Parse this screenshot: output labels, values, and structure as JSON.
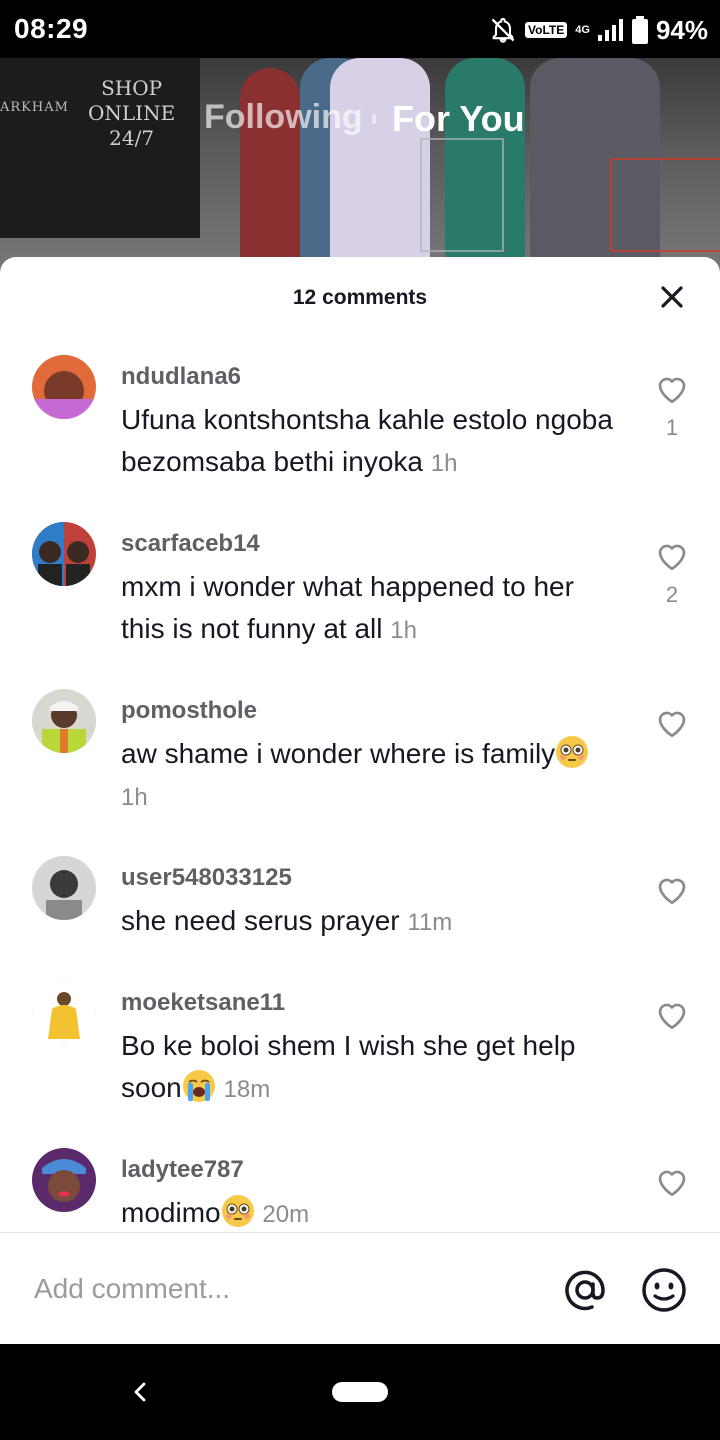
{
  "status_bar": {
    "time": "08:29",
    "volte": "VoLTE",
    "network": "4G",
    "battery": "94%"
  },
  "video": {
    "sign_lines": [
      "SHOP",
      "ONLINE",
      "24/7"
    ],
    "sign_left": "ARKHAM"
  },
  "feed_tabs": {
    "following": "Following",
    "for_you": "For You"
  },
  "comments_sheet": {
    "title": "12 comments",
    "comments": [
      {
        "username": "ndudlana6",
        "text": "Ufuna kontshontsha kahle estolo ngoba bezomsaba bethi inyoka",
        "time": "1h",
        "likes": "1",
        "avatar_color": "#b04a8a"
      },
      {
        "username": "scarfaceb14",
        "text": "mxm i wonder what happened to her this is not funny at all",
        "time": "1h",
        "likes": "2",
        "avatar_color": "#c0413a"
      },
      {
        "username": "pomosthole",
        "text": "aw shame i wonder where is family",
        "emoji": "flushed-face-emoji",
        "time": "1h",
        "likes": "",
        "avatar_color": "#6d7f3a"
      },
      {
        "username": "user548033125",
        "text": "she need serus prayer",
        "time": "11m",
        "likes": "",
        "avatar_color": "#7a7a7a"
      },
      {
        "username": "moeketsane11",
        "text": "Bo ke boloi shem I wish she get help soon",
        "emoji": "crying-face-emoji",
        "time": "18m",
        "likes": "",
        "avatar_color": "#f2c230"
      },
      {
        "username": "ladytee787",
        "text": "modimo",
        "emoji": "flushed-face-emoji",
        "time": "20m",
        "likes": "",
        "avatar_color": "#3a5fb0"
      }
    ]
  },
  "composer": {
    "placeholder": "Add comment..."
  },
  "icons": {
    "close": "close-icon",
    "like": "heart-outline-icon",
    "mention": "at-sign-icon",
    "emoji": "smiley-icon",
    "back": "back-chevron-icon"
  }
}
